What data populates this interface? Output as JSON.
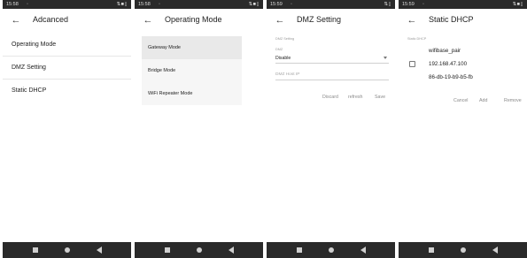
{
  "screens": [
    {
      "status": {
        "time": "15:58",
        "indicator": "◦",
        "icons": "⇅■▯"
      },
      "title": "Adcanced",
      "menu": [
        "Operating Mode",
        "DMZ Setting",
        "Static DHCP"
      ]
    },
    {
      "status": {
        "time": "15:58",
        "indicator": "◦",
        "icons": "⇅■▯"
      },
      "title": "Operating Mode",
      "modes": [
        "Gateway Mode",
        "Bridge Mode",
        "WiFi Repeater Mode"
      ],
      "selected_mode": "Gateway Mode"
    },
    {
      "status": {
        "time": "15:59",
        "indicator": "◦",
        "icons": "⇅▯"
      },
      "title": "DMZ Setting",
      "section_label": "DMZ Setting",
      "dmz_label": "DMZ",
      "dmz_value": "Disable",
      "host_ip_placeholder": "DMZ Host IP",
      "actions": [
        "Discard",
        "refresh",
        "Save"
      ]
    },
    {
      "status": {
        "time": "15:59",
        "indicator": "◦",
        "icons": "⇅■▯"
      },
      "title": "Static DHCP",
      "section_label": "Static DHCP",
      "entry": {
        "name": "wifibase_pair",
        "ip": "192.168.47.100",
        "mac": "86-db-19-b9-b5-fb",
        "checked": false
      },
      "actions": [
        "Cancel",
        "Add",
        "Remove"
      ]
    }
  ],
  "icons": {
    "back": "back-arrow-icon",
    "nav_recents": "square-icon",
    "nav_home": "circle-icon",
    "nav_back": "triangle-back-icon"
  },
  "colors": {
    "bars": "#2a2a2a",
    "text": "#222222",
    "muted": "#8a8a8a",
    "selected_row": "#e9e9e9"
  }
}
